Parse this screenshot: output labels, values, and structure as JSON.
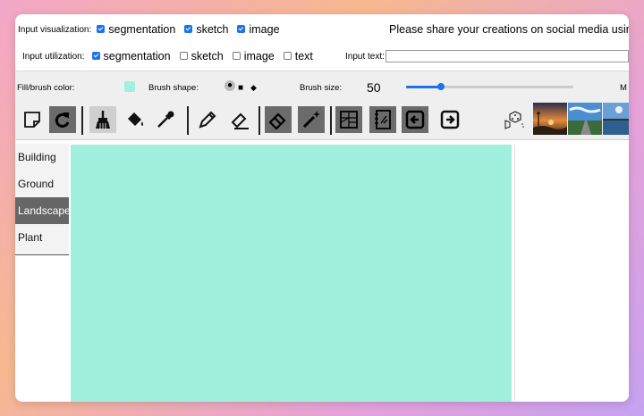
{
  "visualization": {
    "label": "Input visualization:",
    "options": [
      {
        "label": "segmentation",
        "checked": true
      },
      {
        "label": "sketch",
        "checked": true
      },
      {
        "label": "image",
        "checked": true
      }
    ],
    "share_text": "Please share your creations on social media using #"
  },
  "utilization": {
    "label": "Input utilization:",
    "options": [
      {
        "label": "segmentation",
        "checked": true
      },
      {
        "label": "sketch",
        "checked": false
      },
      {
        "label": "image",
        "checked": false
      },
      {
        "label": "text",
        "checked": false
      }
    ],
    "input_text_label": "Input text:",
    "input_text_value": ""
  },
  "brush": {
    "fill_label": "Fill/brush color:",
    "fill_color": "#a1efdd",
    "shape_label": "Brush shape:",
    "shapes": [
      "●",
      "■",
      "◆"
    ],
    "size_label": "Brush size:",
    "size_value": "50",
    "slider_fraction": 0.21,
    "trailing_label": "M"
  },
  "toolbar": {
    "tools": [
      "new-document-icon",
      "redo-icon",
      "brush-icon",
      "paint-bucket-icon",
      "eyedropper-icon",
      "pencil-icon",
      "line-eraser-icon",
      "eraser-icon",
      "magic-wand-icon",
      "segmentation-grid-icon",
      "sketch-notebook-icon",
      "arrow-left-icon",
      "arrow-right-icon",
      "dice-icon"
    ],
    "accent_dark": "#6b6b6b"
  },
  "categories": [
    {
      "label": "Building",
      "active": false
    },
    {
      "label": "Ground",
      "active": false
    },
    {
      "label": "Landscape",
      "active": true
    },
    {
      "label": "Plant",
      "active": false
    }
  ],
  "canvas": {
    "color": "#a1efdd"
  }
}
